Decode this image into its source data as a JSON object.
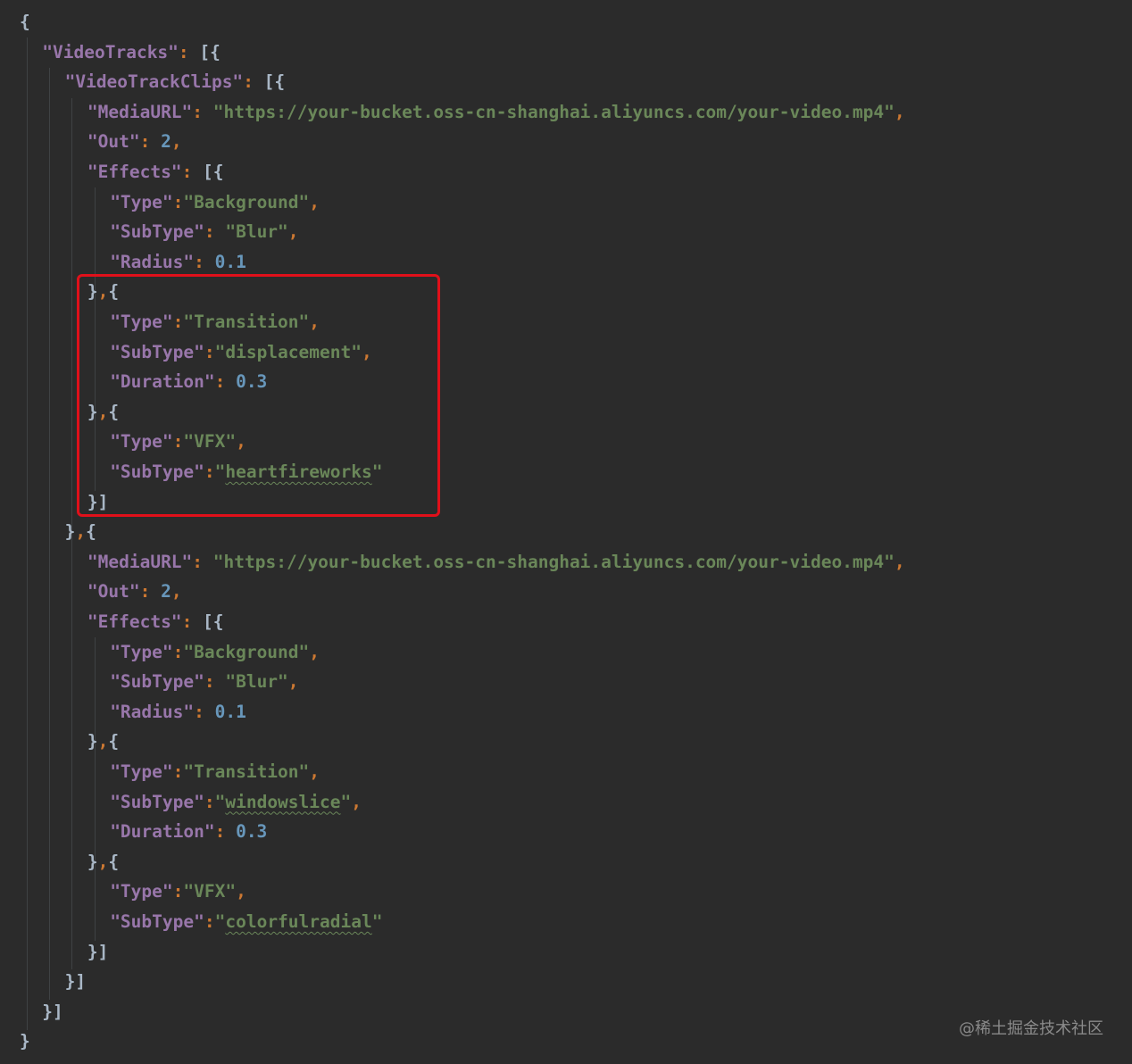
{
  "lines": [
    {
      "parts": [
        {
          "t": "{",
          "c": "b"
        }
      ]
    },
    {
      "parts": [
        {
          "t": "\"VideoTracks\"",
          "c": "k"
        },
        {
          "t": ": ",
          "c": "p"
        },
        {
          "t": "[{",
          "c": "b"
        }
      ]
    },
    {
      "parts": [
        {
          "t": "\"VideoTrackClips\"",
          "c": "k"
        },
        {
          "t": ": ",
          "c": "p"
        },
        {
          "t": "[{",
          "c": "b"
        }
      ]
    },
    {
      "parts": [
        {
          "t": "\"MediaURL\"",
          "c": "k"
        },
        {
          "t": ": ",
          "c": "p"
        },
        {
          "t": "\"https://your-bucket.oss-cn-shanghai.aliyuncs.com/your-video.mp4\"",
          "c": "s"
        },
        {
          "t": ",",
          "c": "p"
        }
      ]
    },
    {
      "parts": [
        {
          "t": "\"Out\"",
          "c": "k"
        },
        {
          "t": ": ",
          "c": "p"
        },
        {
          "t": "2",
          "c": "n"
        },
        {
          "t": ",",
          "c": "p"
        }
      ]
    },
    {
      "parts": [
        {
          "t": "\"Effects\"",
          "c": "k"
        },
        {
          "t": ": ",
          "c": "p"
        },
        {
          "t": "[{",
          "c": "b"
        }
      ]
    },
    {
      "parts": [
        {
          "t": "\"Type\"",
          "c": "k"
        },
        {
          "t": ":",
          "c": "p"
        },
        {
          "t": "\"Background\"",
          "c": "s"
        },
        {
          "t": ",",
          "c": "p"
        }
      ]
    },
    {
      "parts": [
        {
          "t": "\"SubType\"",
          "c": "k"
        },
        {
          "t": ": ",
          "c": "p"
        },
        {
          "t": "\"Blur\"",
          "c": "s"
        },
        {
          "t": ",",
          "c": "p"
        }
      ]
    },
    {
      "parts": [
        {
          "t": "\"Radius\"",
          "c": "k"
        },
        {
          "t": ": ",
          "c": "p"
        },
        {
          "t": "0.1",
          "c": "n"
        }
      ]
    },
    {
      "parts": [
        {
          "t": "}",
          "c": "b"
        },
        {
          "t": ",",
          "c": "p"
        },
        {
          "t": "{",
          "c": "b"
        }
      ]
    },
    {
      "parts": [
        {
          "t": "\"Type\"",
          "c": "k"
        },
        {
          "t": ":",
          "c": "p"
        },
        {
          "t": "\"Transition\"",
          "c": "s"
        },
        {
          "t": ",",
          "c": "p"
        }
      ]
    },
    {
      "parts": [
        {
          "t": "\"SubType\"",
          "c": "k"
        },
        {
          "t": ":",
          "c": "p"
        },
        {
          "t": "\"displacement\"",
          "c": "s"
        },
        {
          "t": ",",
          "c": "p"
        }
      ]
    },
    {
      "parts": [
        {
          "t": "\"Duration\"",
          "c": "k"
        },
        {
          "t": ": ",
          "c": "p"
        },
        {
          "t": "0.3",
          "c": "n"
        }
      ]
    },
    {
      "parts": [
        {
          "t": "}",
          "c": "b"
        },
        {
          "t": ",",
          "c": "p"
        },
        {
          "t": "{",
          "c": "b"
        }
      ]
    },
    {
      "parts": [
        {
          "t": "\"Type\"",
          "c": "k"
        },
        {
          "t": ":",
          "c": "p"
        },
        {
          "t": "\"VFX\"",
          "c": "s"
        },
        {
          "t": ",",
          "c": "p"
        }
      ]
    },
    {
      "parts": [
        {
          "t": "\"SubType\"",
          "c": "k"
        },
        {
          "t": ":",
          "c": "p"
        },
        {
          "t": "\"",
          "c": "s"
        },
        {
          "t": "heartfireworks",
          "c": "s",
          "u": true
        },
        {
          "t": "\"",
          "c": "s"
        }
      ]
    },
    {
      "parts": [
        {
          "t": "}]",
          "c": "b"
        }
      ]
    },
    {
      "parts": [
        {
          "t": "}",
          "c": "b"
        },
        {
          "t": ",",
          "c": "p"
        },
        {
          "t": "{",
          "c": "b"
        }
      ]
    },
    {
      "parts": [
        {
          "t": "\"MediaURL\"",
          "c": "k"
        },
        {
          "t": ": ",
          "c": "p"
        },
        {
          "t": "\"https://your-bucket.oss-cn-shanghai.aliyuncs.com/your-video.mp4\"",
          "c": "s"
        },
        {
          "t": ",",
          "c": "p"
        }
      ]
    },
    {
      "parts": [
        {
          "t": "\"Out\"",
          "c": "k"
        },
        {
          "t": ": ",
          "c": "p"
        },
        {
          "t": "2",
          "c": "n"
        },
        {
          "t": ",",
          "c": "p"
        }
      ]
    },
    {
      "parts": [
        {
          "t": "\"Effects\"",
          "c": "k"
        },
        {
          "t": ": ",
          "c": "p"
        },
        {
          "t": "[{",
          "c": "b"
        }
      ]
    },
    {
      "parts": [
        {
          "t": "\"Type\"",
          "c": "k"
        },
        {
          "t": ":",
          "c": "p"
        },
        {
          "t": "\"Background\"",
          "c": "s"
        },
        {
          "t": ",",
          "c": "p"
        }
      ]
    },
    {
      "parts": [
        {
          "t": "\"SubType\"",
          "c": "k"
        },
        {
          "t": ": ",
          "c": "p"
        },
        {
          "t": "\"Blur\"",
          "c": "s"
        },
        {
          "t": ",",
          "c": "p"
        }
      ]
    },
    {
      "parts": [
        {
          "t": "\"Radius\"",
          "c": "k"
        },
        {
          "t": ": ",
          "c": "p"
        },
        {
          "t": "0.1",
          "c": "n"
        }
      ]
    },
    {
      "parts": [
        {
          "t": "}",
          "c": "b"
        },
        {
          "t": ",",
          "c": "p"
        },
        {
          "t": "{",
          "c": "b"
        }
      ]
    },
    {
      "parts": [
        {
          "t": "\"Type\"",
          "c": "k"
        },
        {
          "t": ":",
          "c": "p"
        },
        {
          "t": "\"Transition\"",
          "c": "s"
        },
        {
          "t": ",",
          "c": "p"
        }
      ]
    },
    {
      "parts": [
        {
          "t": "\"SubType\"",
          "c": "k"
        },
        {
          "t": ":",
          "c": "p"
        },
        {
          "t": "\"",
          "c": "s"
        },
        {
          "t": "windowslice",
          "c": "s",
          "u": true
        },
        {
          "t": "\"",
          "c": "s"
        },
        {
          "t": ",",
          "c": "p"
        }
      ]
    },
    {
      "parts": [
        {
          "t": "\"Duration\"",
          "c": "k"
        },
        {
          "t": ": ",
          "c": "p"
        },
        {
          "t": "0.3",
          "c": "n"
        }
      ]
    },
    {
      "parts": [
        {
          "t": "}",
          "c": "b"
        },
        {
          "t": ",",
          "c": "p"
        },
        {
          "t": "{",
          "c": "b"
        }
      ]
    },
    {
      "parts": [
        {
          "t": "\"Type\"",
          "c": "k"
        },
        {
          "t": ":",
          "c": "p"
        },
        {
          "t": "\"VFX\"",
          "c": "s"
        },
        {
          "t": ",",
          "c": "p"
        }
      ]
    },
    {
      "parts": [
        {
          "t": "\"SubType\"",
          "c": "k"
        },
        {
          "t": ":",
          "c": "p"
        },
        {
          "t": "\"",
          "c": "s"
        },
        {
          "t": "colorfulradial",
          "c": "s",
          "u": true
        },
        {
          "t": "\"",
          "c": "s"
        }
      ]
    },
    {
      "parts": [
        {
          "t": "}]",
          "c": "b"
        }
      ]
    },
    {
      "parts": [
        {
          "t": "}]",
          "c": "b"
        }
      ]
    },
    {
      "parts": [
        {
          "t": "}]",
          "c": "b"
        }
      ]
    },
    {
      "parts": [
        {
          "t": "}",
          "c": "b"
        }
      ]
    }
  ],
  "watermark": "@稀土掘金技术社区",
  "colors": {
    "background": "#2b2b2b",
    "key": "#9876aa",
    "string": "#6a8759",
    "number": "#6897bb",
    "punctuation": "#cc7832",
    "bracket": "#a9b7c6",
    "highlight_box": "#e0101a"
  }
}
